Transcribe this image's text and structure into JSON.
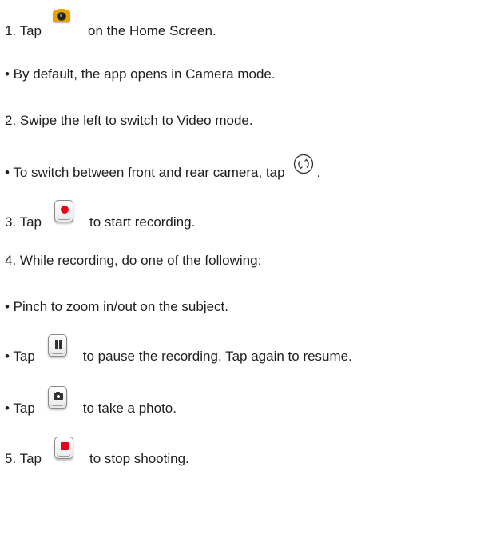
{
  "steps": {
    "s1_prefix": "1. Tap",
    "s1_suffix": "on the Home Screen.",
    "b1": "• By default, the app opens in Camera mode.",
    "s2": "2. Swipe the left to switch to Video mode.",
    "b2_prefix": "• To switch between front and rear camera, tap",
    "b2_suffix": ".",
    "s3_prefix": "3. Tap",
    "s3_suffix": "to start recording.",
    "s4": "4. While recording, do one of the following:",
    "b3": "• Pinch to zoom in/out on the subject.",
    "b4_prefix": "• Tap",
    "b4_suffix": "to pause the recording. Tap again to resume.",
    "b5_prefix": "• Tap",
    "b5_suffix": "to take a photo.",
    "s5_prefix": "5. Tap",
    "s5_suffix": "to stop shooting."
  },
  "icons": {
    "camera_app": "camera-app-icon",
    "switch_camera": "switch-camera-icon",
    "record": "record-button-icon",
    "pause": "pause-button-icon",
    "capture": "capture-photo-button-icon",
    "stop": "stop-button-icon"
  },
  "colors": {
    "text": "#1f1f1f",
    "camera_app": "#e8a500",
    "record_red": "#e8001c"
  }
}
